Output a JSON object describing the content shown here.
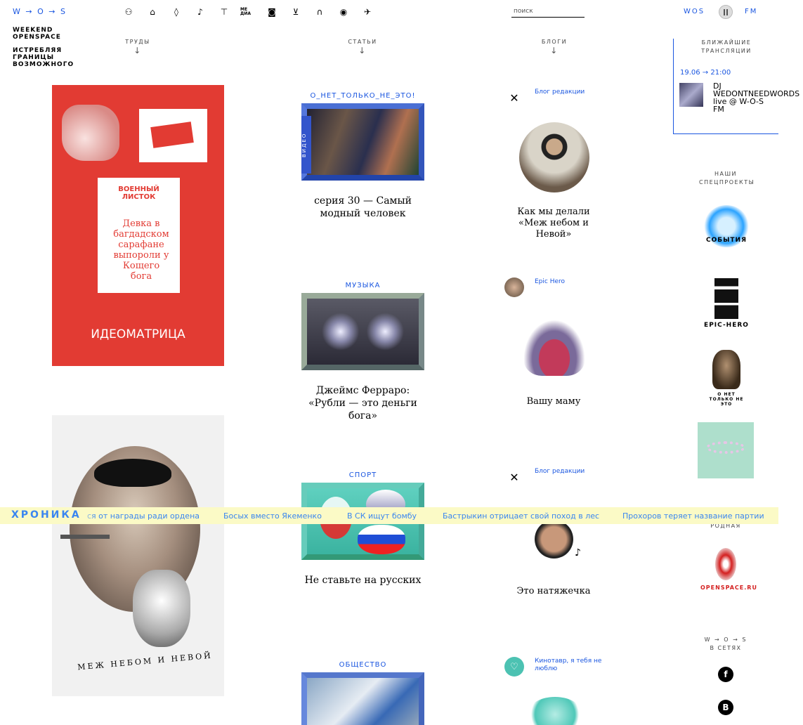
{
  "header": {
    "logo": "W → O → S",
    "sub1": [
      "WEEKEND",
      "OPENSPACE"
    ],
    "sub2": [
      "ИСТРЕБЛЯЯ",
      "ГРАНИЦЫ",
      "ВОЗМОЖНОГО"
    ],
    "nav_icons": [
      "people-icon",
      "cap-icon",
      "drop-icon",
      "guitar-icon",
      "shirt-icon",
      "media-icon",
      "camera-icon",
      "cart-icon",
      "headphones-icon",
      "football-icon",
      "plane-icon"
    ],
    "nav_media_text": "МЕ ДИА",
    "search_placeholder": "поиск",
    "wos": "WOS",
    "fm": "FM"
  },
  "columns": {
    "trudy": "ТРУДЫ",
    "stati": "СТАТЬИ",
    "blogi": "БЛОГИ",
    "arrow": "↓"
  },
  "broadcasts": {
    "title": [
      "БЛИЖАЙШИЕ",
      "ТРАНСЛЯЦИИ"
    ],
    "time": "19.06 → 21:00",
    "name": [
      "DJ",
      "WEDONTNEEDWORDS",
      "live @ W-O-S",
      "FM"
    ]
  },
  "works": [
    {
      "title": "ИДЕОМАТРИЦА",
      "sheet_title": [
        "ВОЕННЫЙ",
        "ЛИСТОК"
      ],
      "sheet_text": [
        "Девка в",
        "багдадском",
        "сарафане",
        "выпороли у",
        "Кощего",
        "бога"
      ]
    },
    {
      "caption": "МЕЖ НЕБОМ И НЕВОЙ"
    }
  ],
  "articles": [
    {
      "category": "О_НЕТ_ТОЛЬКО_НЕ_ЭТО!",
      "label": "ВИДЕО",
      "title": "серия 30 — Самый модный человек"
    },
    {
      "category": "МУЗЫКА",
      "title": "Джеймс Ферраро: «Рубли — это деньги бога»"
    },
    {
      "category": "СПОРТ",
      "title": "Не ставьте на русских"
    },
    {
      "category": "ОБЩЕСТВО"
    }
  ],
  "blogs": [
    {
      "author": "Блог редакции",
      "title": "Как мы делали «Меж небом и Невой»"
    },
    {
      "author": "Epic Hero",
      "title": "Вашу маму"
    },
    {
      "author": "Блог редакции",
      "title": "Это натяжечка"
    },
    {
      "author": "Кинотавр, я тебя не люблю"
    }
  ],
  "specials": {
    "title": [
      "НАШИ",
      "СПЕЦПРОЕКТЫ"
    ],
    "items": [
      "СОБЫТИЯ",
      "EPIC-HERO",
      "О НЕТ ТОЛЬКО НЕ ЭТО"
    ],
    "rodnaya": "РОДНАЯ",
    "openspace": "OPENSPACE.RU",
    "social_logo": "W → O → S",
    "social_title": "В СЕТЯХ",
    "social_icons": [
      "f",
      "В"
    ]
  },
  "chronicle": {
    "label": "ХРОНИКА",
    "items": [
      "ся от награды ради ордена",
      "Босых вместо Якеменко",
      "В СК ищут бомбу",
      "Бастрыкин отрицает свой поход в лес",
      "Прохоров теряет название партии"
    ]
  }
}
